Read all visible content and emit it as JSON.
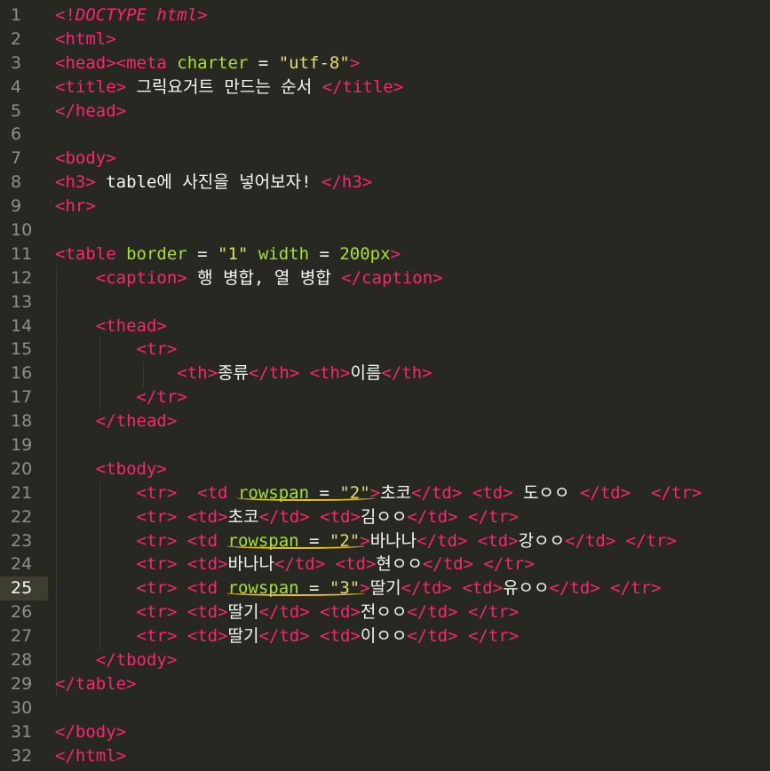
{
  "active_line": 25,
  "line_numbers": [
    "1",
    "2",
    "3",
    "4",
    "5",
    "6",
    "7",
    "8",
    "9",
    "10",
    "11",
    "12",
    "13",
    "14",
    "15",
    "16",
    "17",
    "18",
    "19",
    "20",
    "21",
    "22",
    "23",
    "24",
    "25",
    "26",
    "27",
    "28",
    "29",
    "30",
    "31",
    "32"
  ],
  "code": {
    "l1": [
      "<!",
      "DOCTYPE html",
      ">"
    ],
    "l2": [
      "<html>"
    ],
    "l3": [
      "<head><meta ",
      "charter",
      " = ",
      "\"utf-8\"",
      ">"
    ],
    "l4": [
      "<title>",
      " 그릭요거트 만드는 순서 ",
      "</title>"
    ],
    "l5": [
      "</head>"
    ],
    "l7": [
      "<body>"
    ],
    "l8": [
      "<h3>",
      " table에 사진을 넣어보자! ",
      "</h3>"
    ],
    "l9": [
      "<hr>"
    ],
    "l11": [
      "<table ",
      "border",
      " = ",
      "\"1\"",
      " ",
      "width",
      " = ",
      "200px",
      ">"
    ],
    "l12": [
      "<caption>",
      " 행 병합, 열 병합 ",
      "</caption>"
    ],
    "l14": [
      "<thead>"
    ],
    "l15": [
      "<tr>"
    ],
    "l16": [
      "<th>",
      "종류",
      "</th>",
      " ",
      "<th>",
      "이름",
      "</th>"
    ],
    "l17": [
      "</tr>"
    ],
    "l18": [
      "</thead>"
    ],
    "l20": [
      "<tbody>"
    ],
    "l21": [
      "<tr>",
      "  ",
      "<td ",
      "rowspan = \"2\"",
      ">",
      "초코",
      "</td>",
      " ",
      "<td>",
      " 도ㅇㅇ ",
      "</td>",
      "  ",
      "</tr>"
    ],
    "l22": [
      "<tr>",
      " ",
      "<td>",
      "초코",
      "</td>",
      " ",
      "<td>",
      "김ㅇㅇ",
      "</td>",
      " ",
      "</tr>"
    ],
    "l23": [
      "<tr>",
      " ",
      "<td ",
      "rowspan = \"2\"",
      ">",
      "바나나",
      "</td>",
      " ",
      "<td>",
      "강ㅇㅇ",
      "</td>",
      " ",
      "</tr>"
    ],
    "l24": [
      "<tr>",
      " ",
      "<td>",
      "바나나",
      "</td>",
      " ",
      "<td>",
      "현ㅇㅇ",
      "</td>",
      " ",
      "</tr>"
    ],
    "l25": [
      "<tr>",
      " ",
      "<td ",
      "rowspan = \"3\"",
      ">",
      "딸기",
      "</td>",
      " ",
      "<td>",
      "유ㅇㅇ",
      "</td>",
      " ",
      "</tr>"
    ],
    "l26": [
      "<tr>",
      " ",
      "<td>",
      "딸기",
      "</td>",
      " ",
      "<td>",
      "전ㅇㅇ",
      "</td>",
      " ",
      "</tr>"
    ],
    "l27": [
      "<tr>",
      " ",
      "<td>",
      "딸기",
      "</td>",
      " ",
      "<td>",
      "이ㅇㅇ",
      "</td>",
      " ",
      "</tr>"
    ],
    "l28": [
      "</tbody>"
    ],
    "l29": [
      "</table>"
    ],
    "l31": [
      "</body>"
    ],
    "l32": [
      "</html>"
    ]
  },
  "colors": {
    "background": "#272822",
    "tag": "#f92672",
    "attribute": "#a6e22e",
    "string": "#e6db74",
    "number": "#ae81ff",
    "text": "#f8f8f2",
    "line_number": "#8f908a",
    "annotation_underline": "#e9c41b"
  }
}
